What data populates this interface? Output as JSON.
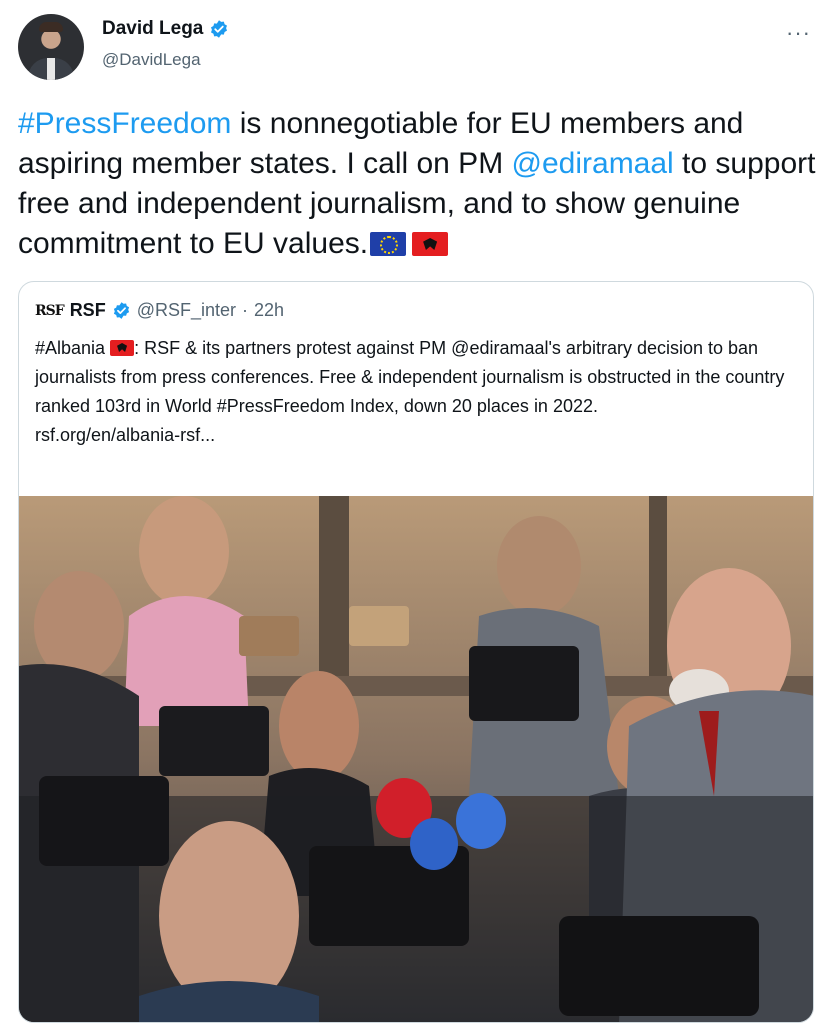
{
  "author": {
    "name": "David Lega",
    "handle": "@DavidLega",
    "more_label": "···"
  },
  "tweet": {
    "hashtag": "#PressFreedom",
    "text_part1": " is nonnegotiable for EU members and aspiring member states. I call on PM ",
    "mention": "@ediramaal",
    "text_part2": " to support free and independent journalism, and to show genuine commitment to EU values.",
    "flags": [
      "eu-flag-icon",
      "albania-flag-icon"
    ]
  },
  "quoted": {
    "logo": "RSF",
    "name": "RSF",
    "handle": "@RSF_inter",
    "separator": "·",
    "time": "22h",
    "text_part1": "#Albania ",
    "text_part2": ": RSF & its partners protest against PM @ediramaal's arbitrary decision to ban journalists from press conferences. Free & independent journalism is obstructed in the country ranked 103rd in World #PressFreedom Index, down 20 places in 2022.",
    "link": "rsf.org/en/albania-rsf...",
    "media_icon": "press-conference-photo"
  },
  "colors": {
    "link": "#1d9bf0",
    "verified": "#1d9bf0",
    "muted": "#536471",
    "border": "#cfd9de"
  }
}
